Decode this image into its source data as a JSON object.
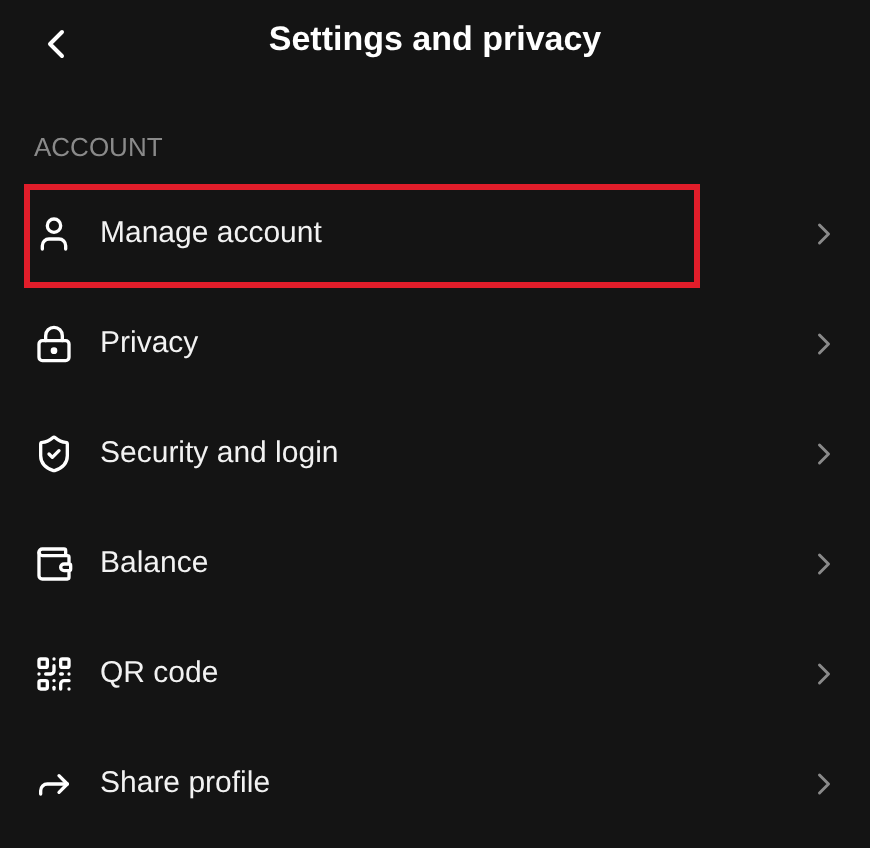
{
  "header": {
    "title": "Settings and privacy"
  },
  "section": {
    "heading": "ACCOUNT"
  },
  "items": [
    {
      "label": "Manage account",
      "highlighted": true
    },
    {
      "label": "Privacy",
      "highlighted": false
    },
    {
      "label": "Security and login",
      "highlighted": false
    },
    {
      "label": "Balance",
      "highlighted": false
    },
    {
      "label": "QR code",
      "highlighted": false
    },
    {
      "label": "Share profile",
      "highlighted": false
    }
  ]
}
